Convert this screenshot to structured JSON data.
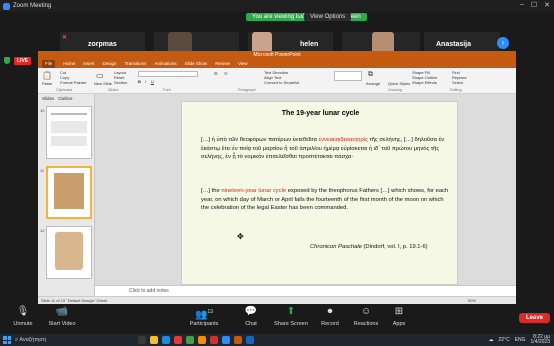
{
  "window": {
    "title": "Zoom Meeting"
  },
  "banner": {
    "share_indicator": "You are viewing Ιωάννα Σκούρα's screen",
    "view_options": "View Options"
  },
  "participants": [
    {
      "name": "zorpmas"
    },
    {
      "name": "helen"
    },
    {
      "name": "Anastasija"
    }
  ],
  "live_badge": "LIVE",
  "ppt": {
    "title_bar": "Microsoft PowerPoint",
    "tabs": [
      "File",
      "Home",
      "Insert",
      "Design",
      "Transitions",
      "Animations",
      "Slide Show",
      "Review",
      "View"
    ],
    "ribbon": {
      "paste": "Paste",
      "cut": "Cut",
      "copy": "Copy",
      "format_painter": "Format Painter",
      "clipboard_group": "Clipboard",
      "new_slide": "New Slide",
      "layout": "Layout",
      "reset": "Reset",
      "section": "Section",
      "slides_group": "Slides",
      "font_group": "Font",
      "paragraph_group": "Paragraph",
      "text_direction": "Text Direction",
      "align_text": "Align Text",
      "convert_smartart": "Convert to SmartArt",
      "arrange": "Arrange",
      "quick_styles": "Quick Styles",
      "shape_fill": "Shape Fill",
      "shape_outline": "Shape Outline",
      "shape_effects": "Shape Effects",
      "drawing_group": "Drawing",
      "find": "Find",
      "replace": "Replace",
      "select": "Select",
      "editing_group": "Editing"
    },
    "side_tabs": [
      "Slides",
      "Outline"
    ],
    "thumb_numbers": [
      "10",
      "11",
      "12"
    ],
    "slide": {
      "title": "The 19-year lunar cycle",
      "greek_pre": "[…] ἡ  ὑπὸ τῶν θεοφόρων  πατέρων ἐκτεθεῖσα ",
      "greek_red": "ἐννεακαιδεκαετηρίς",
      "greek_post": " τῆς σελήνης, […] δηλοῦσα ἐν ἑκάστῳ ἔτει ἐν ποίᾳ τοῦ μαρτίου ἢ τοῦ ἀπριλίου ἡμέρᾳ εὑρίσκεται ἡ ιδ΄ τοῦ πρώτου μηνὸς τῆς σελήνης, ἐν ᾗ τὸ νομικὸν ἐπιτελεῖσθαι προστέτακται πάσχα·",
      "eng_pre": "[…] the ",
      "eng_red": "nineteen-year lunar cycle",
      "eng_post": " exposed by the theophorus Fathers […] which shows, for each year, on which day of March or April falls the fourteenth  of the first month of the moon on which the celebration of the legal Easter has been commanded.",
      "source_italic": "Chronicon Paschale",
      "source_rest": " (Dindorf, vol. I, p. 19.1-6)"
    },
    "notes_placeholder": "Click to add notes",
    "status_left": "Slide 11 of 19   \"Default Design\"   Greek",
    "zoom_level": "90%"
  },
  "toolbar": {
    "unmute": "Unmute",
    "start_video": "Start Video",
    "participants": "Participants",
    "participants_count": "13",
    "chat": "Chat",
    "share_screen": "Share Screen",
    "record": "Record",
    "reactions": "Reactions",
    "apps": "Apps",
    "leave": "Leave"
  },
  "taskbar": {
    "search_placeholder": "Αναζήτηση",
    "weather": "22°C",
    "language": "ENG",
    "time": "8:22 μμ",
    "date": "1/4/2023"
  }
}
